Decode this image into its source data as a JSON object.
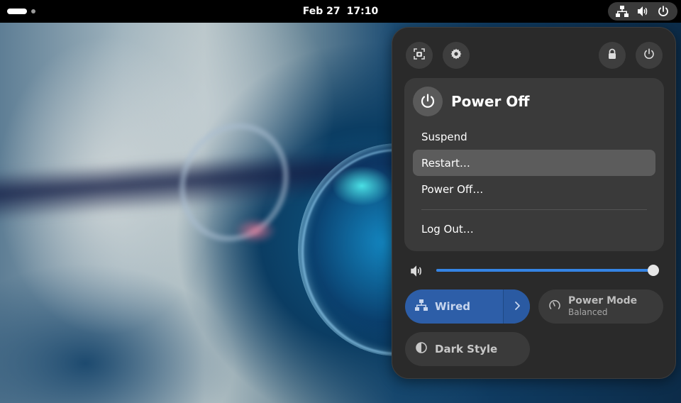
{
  "topbar": {
    "date": "Feb 27",
    "time": "17:10",
    "indicators": [
      "network-wired-icon",
      "volume-icon",
      "power-icon"
    ]
  },
  "panel": {
    "top_buttons": [
      {
        "name": "screenshot-button",
        "icon": "screenshot-icon"
      },
      {
        "name": "settings-button",
        "icon": "gear-icon"
      },
      {
        "name": "lock-button",
        "icon": "lock-icon"
      },
      {
        "name": "power-button",
        "icon": "power-icon"
      }
    ],
    "power_menu": {
      "title": "Power Off",
      "items": [
        {
          "label": "Suspend"
        },
        {
          "label": "Restart…"
        },
        {
          "label": "Power Off…"
        },
        {
          "label": "Log Out…"
        }
      ],
      "highlighted_item": "Restart…"
    },
    "volume": {
      "level": 1.0
    },
    "tiles": {
      "wired": {
        "label": "Wired",
        "active": true
      },
      "power_mode": {
        "label": "Power Mode",
        "sublabel": "Balanced"
      },
      "dark_style": {
        "label": "Dark Style"
      }
    }
  },
  "colors": {
    "accent": "#3584e4",
    "panel_bg": "#2a2a2a",
    "submenu_bg": "#3a3a3a",
    "wired_tile": "#2d5ea8"
  }
}
